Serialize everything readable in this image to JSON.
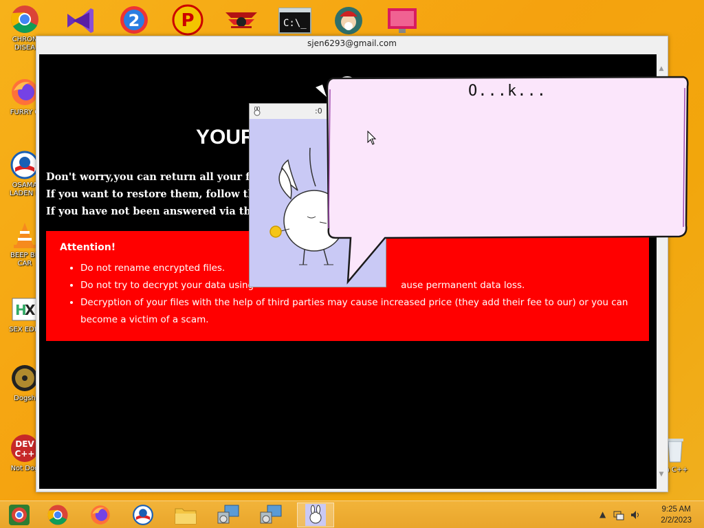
{
  "desktop": {
    "left_icons": [
      {
        "name": "chrome",
        "label": "CHRON\nDISEA"
      },
      {
        "name": "firefox",
        "label": "FURRY C"
      },
      {
        "name": "obama",
        "label": "OSAMA\nLADEN B"
      },
      {
        "name": "vlc",
        "label": "BEEP BE\nCAR"
      },
      {
        "name": "hex",
        "label": "SEX EDIT"
      },
      {
        "name": "dogs",
        "label": "Dogsh"
      },
      {
        "name": "devcpp",
        "label": "Not Dog"
      }
    ],
    "right_icon_label": "n C++"
  },
  "main_window": {
    "title": "sjen6293@gmail.com",
    "headline": "YOUR",
    "lines": [
      "Don't worry,you can return all your files",
      "If you want to restore them, follow this",
      "If you have not been answered via the li"
    ],
    "attention": {
      "heading": "Attention!",
      "items": [
        "Do not rename encrypted files.",
        "Do not try to decrypt your data using",
        "ause permanent data loss.",
        "Decryption of your files with the help of third parties may cause increased price (they add their fee to our) or you can become a victim of a scam."
      ]
    }
  },
  "bunny_window": {
    "title": ":0"
  },
  "speech_bubble": {
    "text": "O...k..."
  },
  "taskbar": {
    "time": "9:25 AM",
    "date": "2/2/2023"
  },
  "colors": {
    "wallpaper": "#f5a20f",
    "attention_bg": "#ff0000",
    "bubble_fill": "#fbe6fb",
    "bunny_bg": "#c9c9f5"
  }
}
